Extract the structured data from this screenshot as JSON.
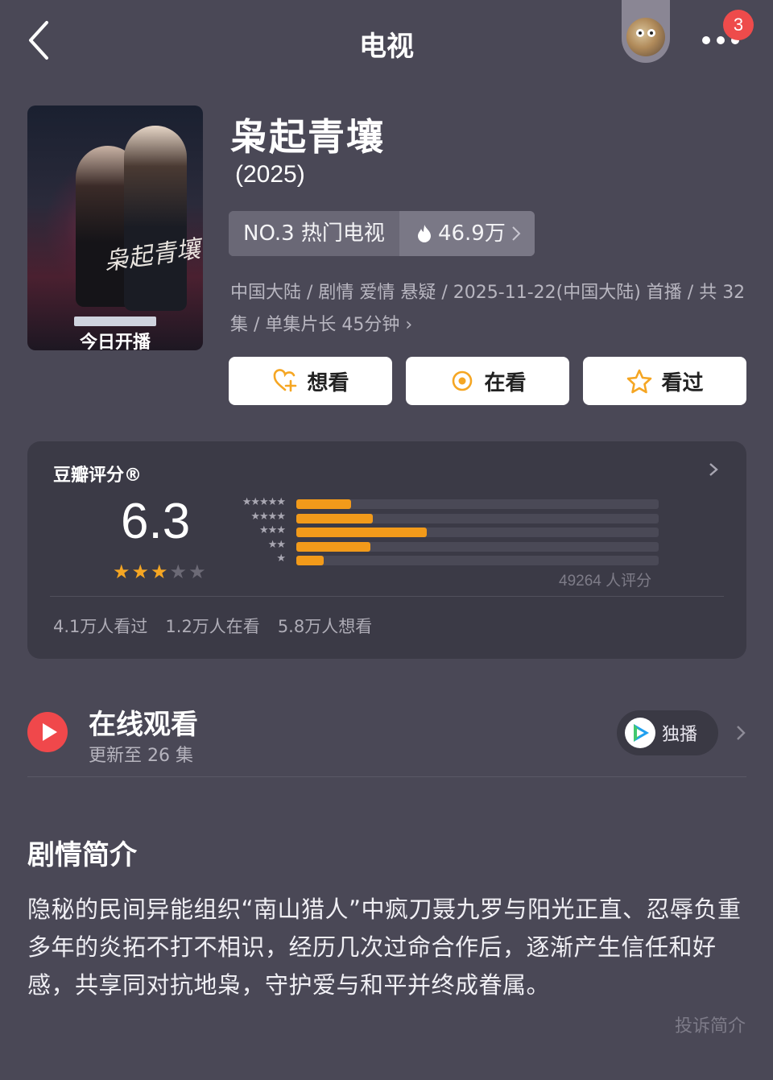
{
  "nav": {
    "title": "电视",
    "badge_count": "3"
  },
  "show": {
    "poster_banner": "今日开播",
    "poster_calligraphy": "枭起青壤",
    "title": "枭起青壤",
    "year": "(2025)",
    "rank_label": "NO.3 热门电视",
    "heat": "46.9万",
    "meta": "中国大陆 / 剧情 爱情 悬疑 / 2025-11-22(中国大陆) 首播 / 共 32集 / 单集片长 45分钟 ›"
  },
  "actions": {
    "want_label": "想看",
    "watching_label": "在看",
    "watched_label": "看过"
  },
  "rating": {
    "title": "豆瓣评分®",
    "score": "6.3",
    "stars_filled": 3,
    "stars_total": 5,
    "distribution": [
      {
        "stars": 5,
        "share": 0.15
      },
      {
        "stars": 4,
        "share": 0.21
      },
      {
        "stars": 3,
        "share": 0.36
      },
      {
        "stars": 2,
        "share": 0.205
      },
      {
        "stars": 1,
        "share": 0.075
      }
    ],
    "count": "49264 人评分",
    "watched": "4.1万人看过",
    "watching": "1.2万人在看",
    "want": "5.8万人想看",
    "bar_color": "#f29a1a"
  },
  "watch": {
    "title": "在线观看",
    "subtitle": "更新至 26 集",
    "exclusive_label": "独播"
  },
  "synopsis": {
    "title": "剧情简介",
    "body": "隐秘的民间异能组织“南山猎人”中疯刀聂九罗与阳光正直、忍辱负重多年的炎拓不打不相识，经历几次过命合作后，逐渐产生信任和好感，共享同对抗地枭，守护爱与和平并终成眷属。",
    "report_label": "投诉简介"
  }
}
